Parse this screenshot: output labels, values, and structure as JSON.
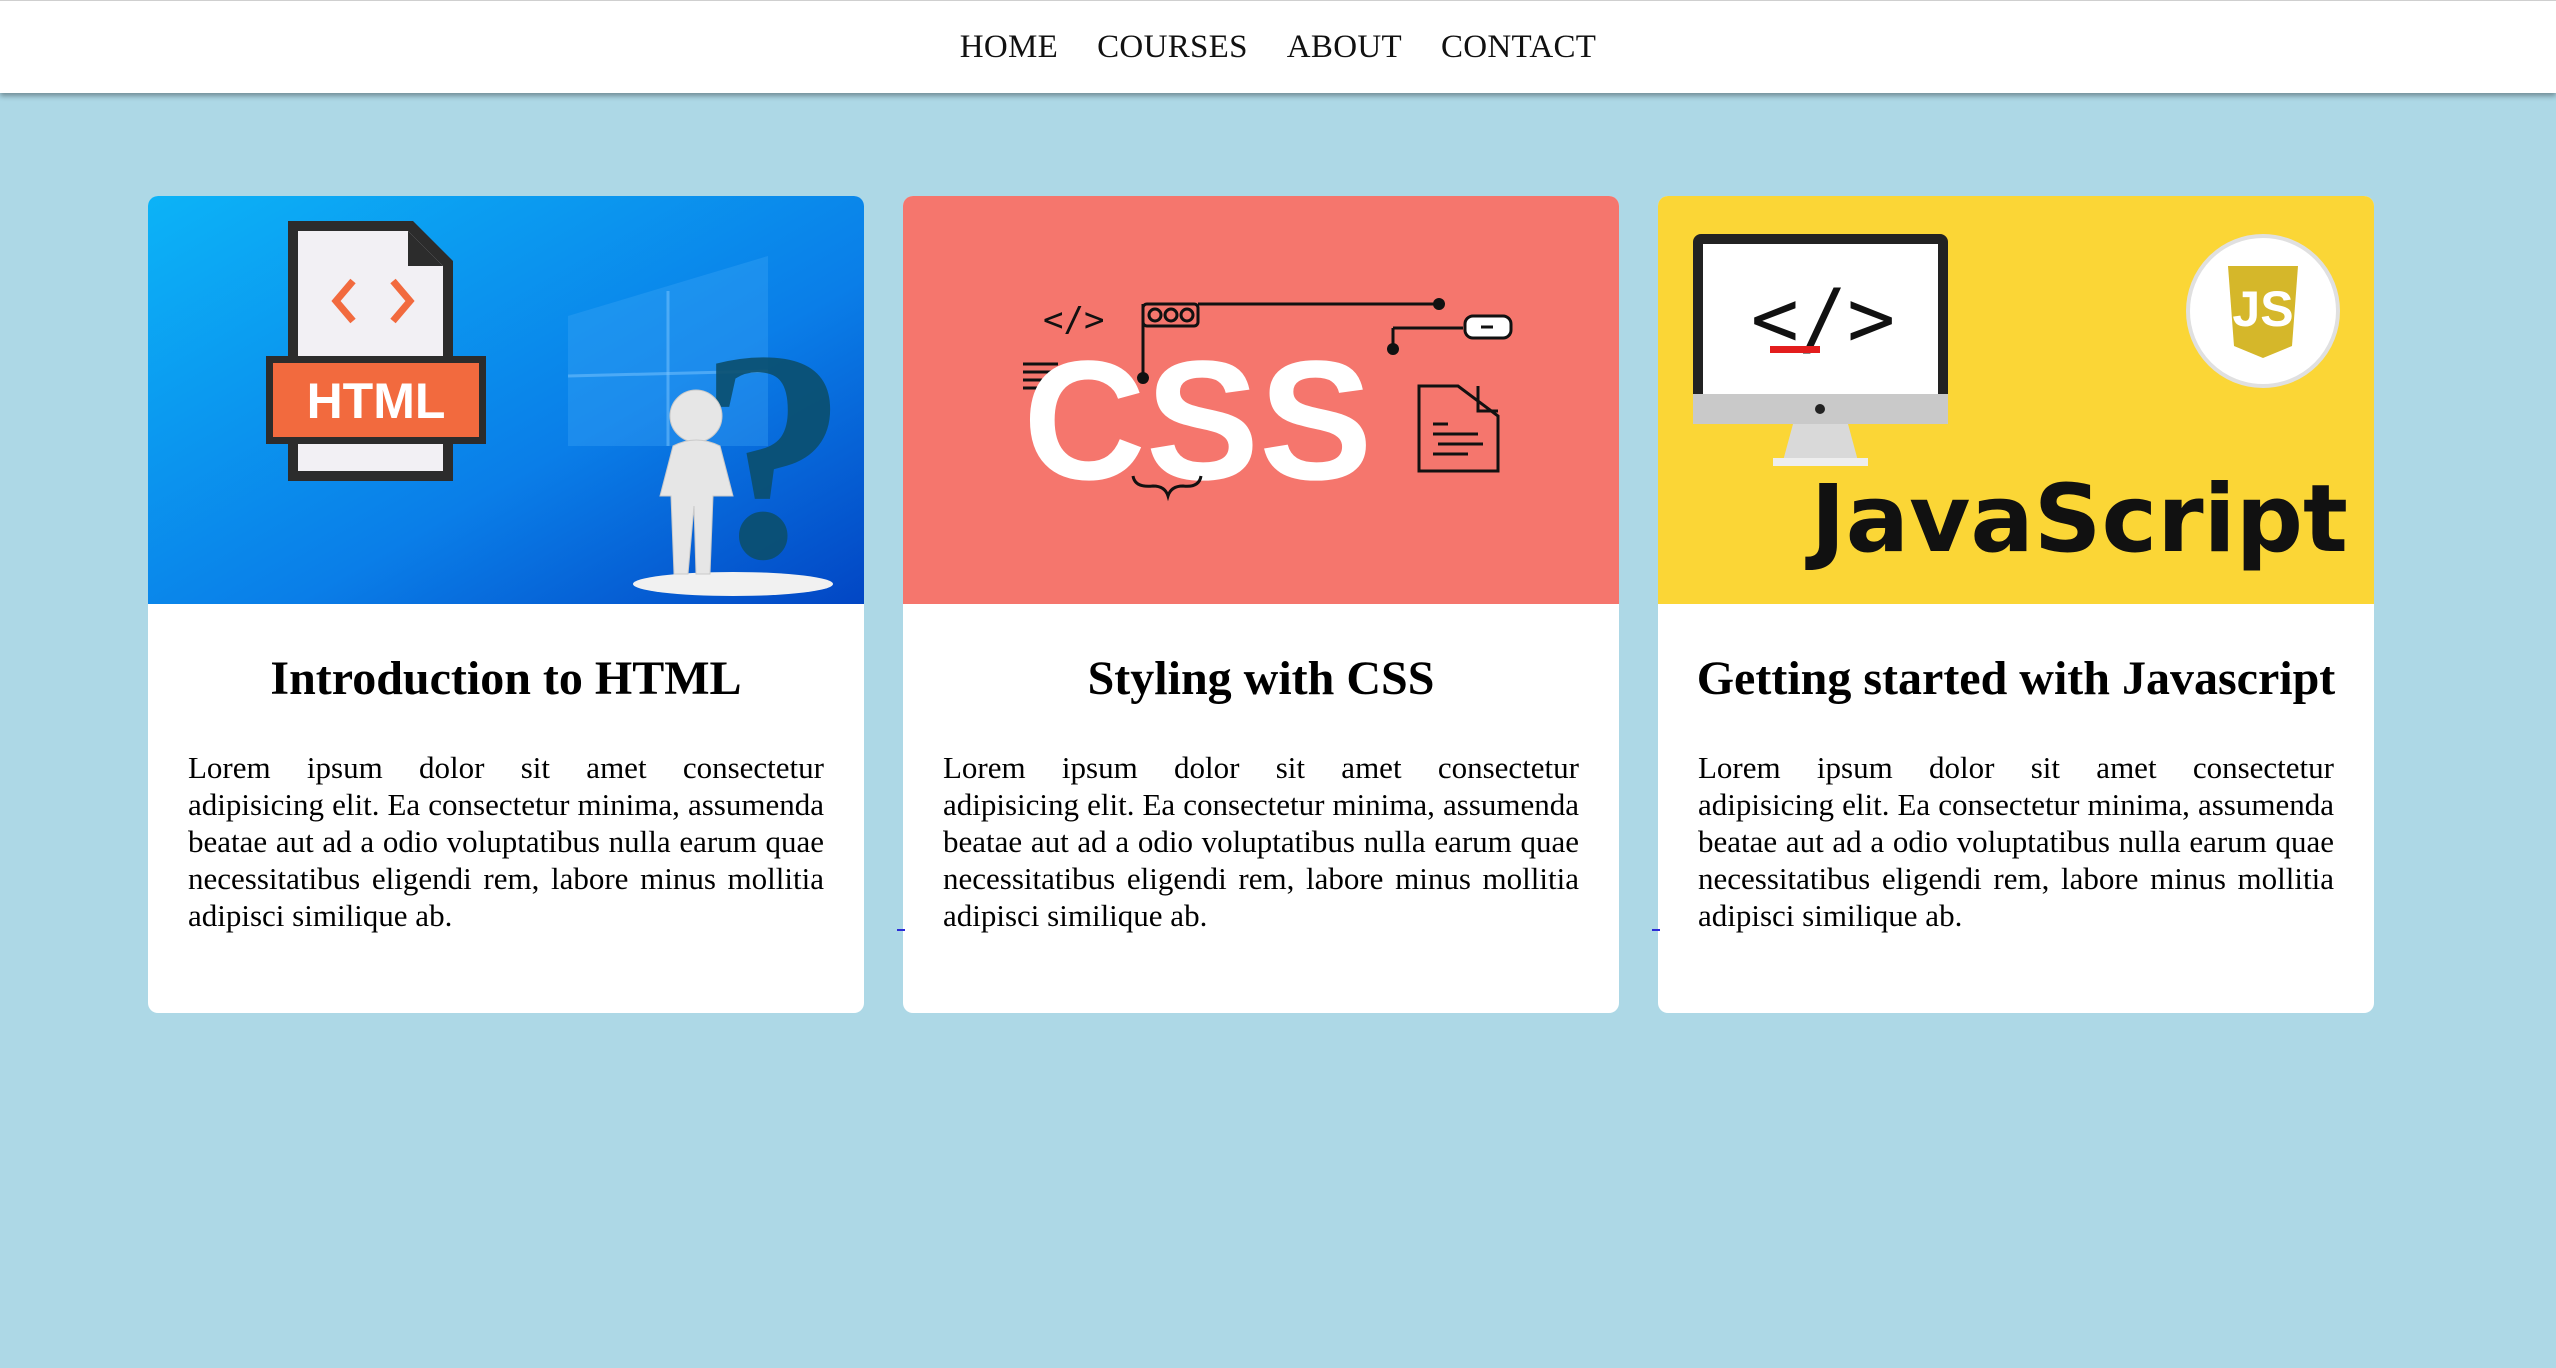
{
  "nav": {
    "items": [
      {
        "label": "HOME"
      },
      {
        "label": "COURSES"
      },
      {
        "label": "ABOUT"
      },
      {
        "label": "CONTACT"
      }
    ]
  },
  "cards": [
    {
      "title": "Introduction to HTML",
      "image_badge": "HTML",
      "image_icon": "html-file-icon",
      "description": "Lorem ipsum dolor sit amet consectetur adipisicing elit. Ea consectetur minima, assumenda beatae aut ad a odio voluptatibus nulla earum quae necessitatibus eligendi rem, labore minus mollitia adipisci similique ab.",
      "image_bg": "#0a8ef0"
    },
    {
      "title": "Styling with CSS",
      "image_text": "CSS",
      "image_tag": "</>",
      "image_icon": "css-code-illustration",
      "description": "Lorem ipsum dolor sit amet consectetur adipisicing elit. Ea consectetur minima, assumenda beatae aut ad a odio voluptatibus nulla earum quae necessitatibus eligendi rem, labore minus mollitia adipisci similique ab.",
      "image_bg": "#f5766d"
    },
    {
      "title": "Getting started with Javascript",
      "image_text": "JavaScript",
      "image_monitor_text": "</>",
      "image_badge": "JS",
      "image_icon": "monitor-code-icon",
      "description": "Lorem ipsum dolor sit amet consectetur adipisicing elit. Ea consectetur minima, assumenda beatae aut ad a odio voluptatibus nulla earum quae necessitatibus eligendi rem, labore minus mollitia adipisci similique ab.",
      "image_bg": "#fbd636"
    }
  ]
}
